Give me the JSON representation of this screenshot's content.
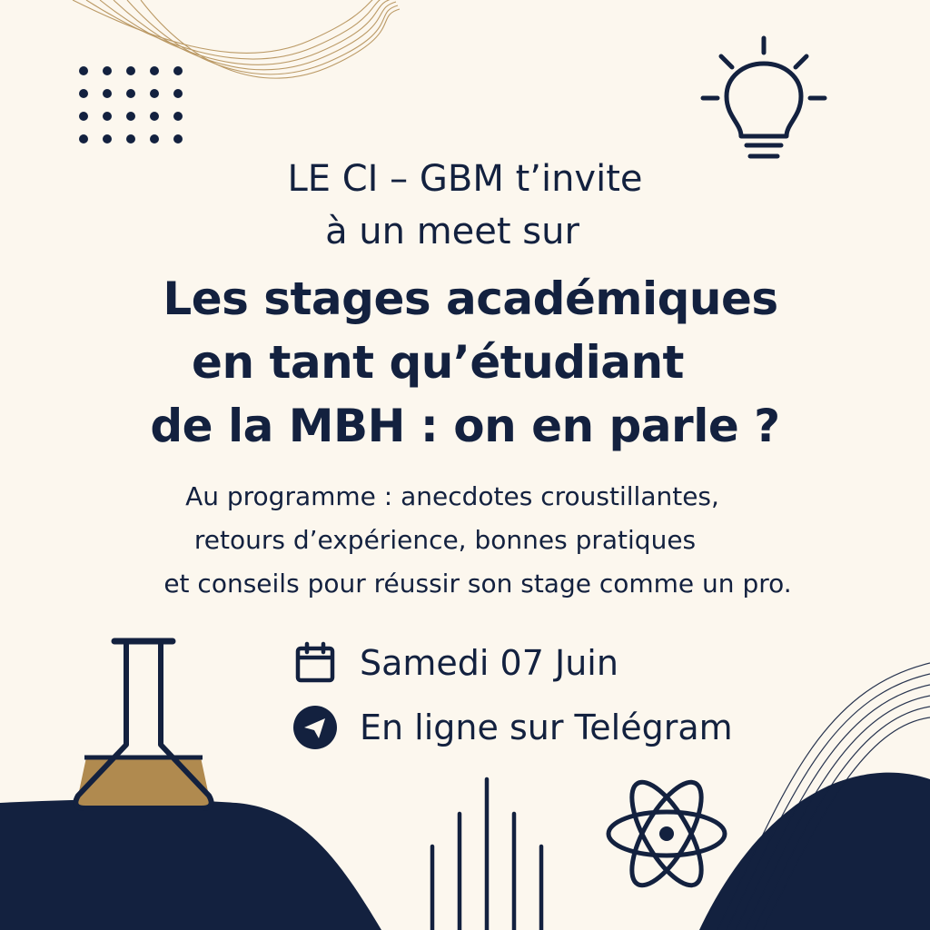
{
  "invite": {
    "line1": "LE CI – GBM t’invite",
    "line2": "à un meet sur"
  },
  "headline": {
    "line1": "Les stages académiques",
    "line2": "en tant qu’étudiant",
    "line3": "de la MBH : on en parle ?"
  },
  "program": {
    "line1": "Au programme : anecdotes croustillantes,",
    "line2": "retours d’expérience, bonnes pratiques",
    "line3": "et conseils pour réussir son stage comme un pro."
  },
  "event": {
    "date": "Samedi 07 Juin",
    "platform": "En ligne sur Telégram"
  },
  "colors": {
    "background": "#fcf7ee",
    "navy": "#13213f",
    "gold": "#b08a4f"
  },
  "icons": [
    "dots-grid-icon",
    "lightbulb-icon",
    "flask-icon",
    "calendar-icon",
    "telegram-icon",
    "atom-icon",
    "waveform-lines-icon"
  ]
}
